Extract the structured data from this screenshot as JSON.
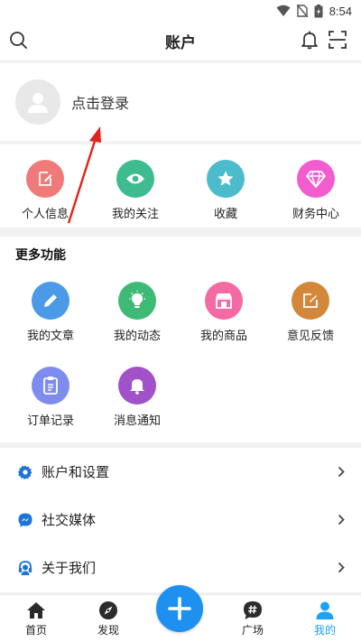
{
  "status": {
    "time": "8:54"
  },
  "header": {
    "title": "账户"
  },
  "profile": {
    "login_label": "点击登录"
  },
  "quick": [
    {
      "label": "个人信息",
      "icon": "edit-icon",
      "color": "#f07a7a"
    },
    {
      "label": "我的关注",
      "icon": "eye-icon",
      "color": "#3ebb8f"
    },
    {
      "label": "收藏",
      "icon": "star-icon",
      "color": "#4cbccc"
    },
    {
      "label": "财务中心",
      "icon": "diamond-icon",
      "color": "#f25ccf"
    }
  ],
  "more": {
    "heading": "更多功能",
    "items": [
      {
        "label": "我的文章",
        "icon": "pencil-icon",
        "color": "#4a9ae8"
      },
      {
        "label": "我的动态",
        "icon": "lightbulb-icon",
        "color": "#3dbb76"
      },
      {
        "label": "我的商品",
        "icon": "shop-icon",
        "color": "#f46aa5"
      },
      {
        "label": "意见反馈",
        "icon": "feedback-icon",
        "color": "#d3873b"
      },
      {
        "label": "订单记录",
        "icon": "clipboard-icon",
        "color": "#7e8cf0"
      },
      {
        "label": "消息通知",
        "icon": "bell-icon",
        "color": "#a252c9"
      }
    ]
  },
  "menu": [
    {
      "label": "账户和设置",
      "icon": "gear-icon"
    },
    {
      "label": "社交媒体",
      "icon": "messenger-icon"
    },
    {
      "label": "关于我们",
      "icon": "headset-icon"
    }
  ],
  "tabs": [
    {
      "label": "首页",
      "icon": "home-icon"
    },
    {
      "label": "发现",
      "icon": "compass-icon"
    },
    {
      "label": "广场",
      "icon": "hashtag-chat-icon"
    },
    {
      "label": "我的",
      "icon": "user-icon"
    }
  ],
  "colors": {
    "accent": "#1e90f0",
    "tab_active": "#1da1f2"
  }
}
